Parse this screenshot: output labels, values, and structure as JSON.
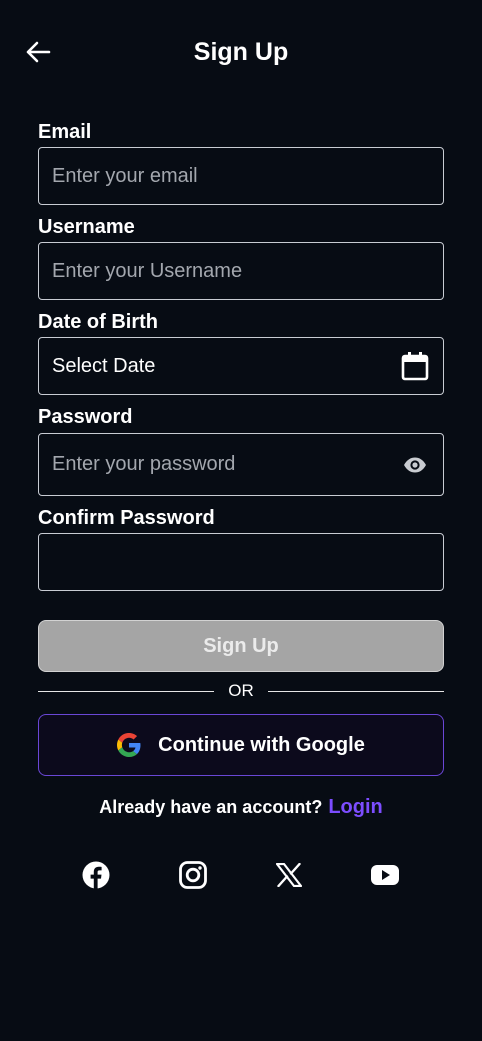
{
  "header": {
    "title": "Sign Up",
    "back_icon": "arrow-left-icon"
  },
  "form": {
    "email": {
      "label": "Email",
      "placeholder": "Enter your email",
      "value": ""
    },
    "username": {
      "label": "Username",
      "placeholder": "Enter your Username",
      "value": ""
    },
    "dob": {
      "label": "Date of Birth",
      "value": "Select Date",
      "icon": "calendar-icon"
    },
    "password": {
      "label": "Password",
      "placeholder": "Enter your password",
      "value": "",
      "icon": "eye-icon"
    },
    "confirm_password": {
      "label": "Confirm Password",
      "placeholder": "",
      "value": ""
    }
  },
  "actions": {
    "signup_label": "Sign Up",
    "divider_text": "OR",
    "google_label": "Continue with Google",
    "google_icon": "google-icon"
  },
  "login": {
    "prompt": "Already have an account?",
    "link_label": "Login"
  },
  "social": [
    {
      "name": "facebook-icon"
    },
    {
      "name": "instagram-icon"
    },
    {
      "name": "x-icon"
    },
    {
      "name": "youtube-icon"
    }
  ],
  "colors": {
    "background": "#070c14",
    "accent": "#7c4dff",
    "google_border": "#6a47d6",
    "disabled_button": "#a5a5a5"
  }
}
